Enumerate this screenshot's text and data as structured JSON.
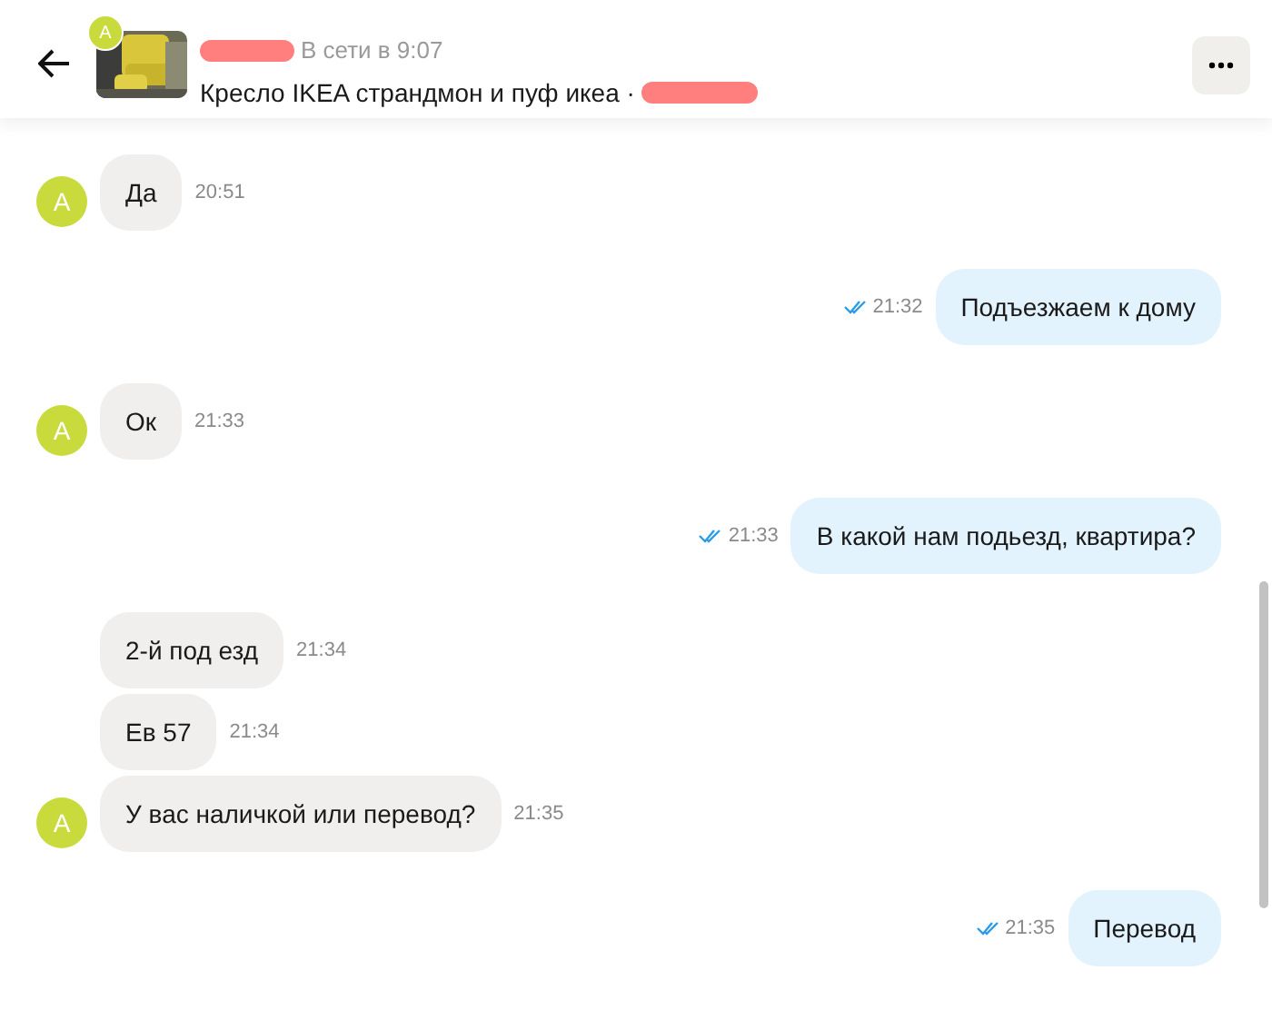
{
  "header": {
    "avatar_letter": "A",
    "status": "В сети в 9:07",
    "listing": "Кресло IKEA страндмон и пуф икеа ·"
  },
  "messages": [
    {
      "kind": "incoming",
      "text": "Да",
      "time": "20:51",
      "avatar": "A"
    },
    {
      "kind": "outgoing",
      "text": "Подъезжаем к дому",
      "time": "21:32",
      "read": true
    },
    {
      "kind": "incoming",
      "text": "Ок",
      "time": "21:33",
      "avatar": "A"
    },
    {
      "kind": "outgoing",
      "text": "В какой нам подьезд, квартира?",
      "time": "21:33",
      "read": true
    },
    {
      "kind": "incoming",
      "text": "2-й под езд",
      "time": "21:34"
    },
    {
      "kind": "incoming",
      "text": "Ев 57",
      "time": "21:34"
    },
    {
      "kind": "incoming",
      "text": "У вас наличкой или перевод?",
      "time": "21:35",
      "avatar": "A"
    },
    {
      "kind": "outgoing",
      "text": "Перевод",
      "time": "21:35",
      "read": true
    }
  ]
}
